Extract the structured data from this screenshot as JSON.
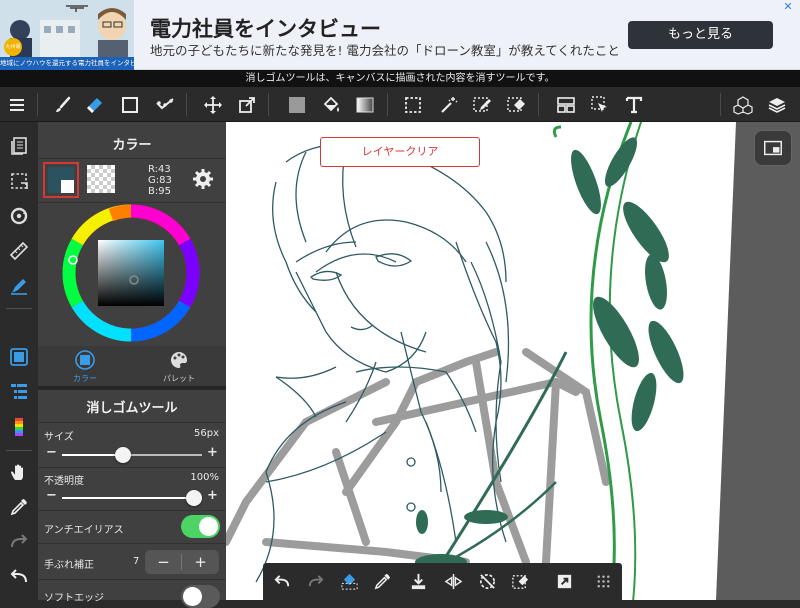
{
  "ad": {
    "title": "電力社員をインタビュー",
    "description": "地元の子どもたちに新たな発見を! 電力会社の「ドローン教室」が教えてくれたこと",
    "button_label": "もっと見る",
    "image_caption": "地域にノウハウを還元する電力社員をインタビュー!",
    "image_badge": "九州電力",
    "close_glyph": "✕"
  },
  "tool_hint": "消しゴムツールは、キャンバスに描画された内容を消すツールです。",
  "colors": {
    "accent": "#3a9be6",
    "toggle_on": "#4cd464",
    "current_color": "#2B535F",
    "selected_border": "#d23a3a",
    "canvas_line": "#2f5a63",
    "leaf_green": "#2f6b55",
    "stem_green": "#2e9b48"
  },
  "color_panel": {
    "title": "カラー",
    "rgb": {
      "r": "R:43",
      "g": "G:83",
      "b": "B:95"
    },
    "tabs": [
      {
        "label": "カラー",
        "icon": "color-square-icon",
        "active": true
      },
      {
        "label": "パレット",
        "icon": "palette-icon",
        "active": false
      }
    ]
  },
  "tool_panel": {
    "title": "消しゴムツール",
    "size": {
      "label": "サイズ",
      "value": "56px",
      "level": 0.43
    },
    "opacity": {
      "label": "不透明度",
      "value": "100%",
      "level": 1.0
    },
    "antialias": {
      "label": "アンチエイリアス",
      "on": true
    },
    "stabilizer": {
      "label": "手ぶれ補正",
      "value": "7",
      "minus": "−",
      "plus": "+"
    },
    "soft_edge": {
      "label": "ソフトエッジ",
      "on": false
    },
    "minus": "−",
    "plus": "+"
  },
  "canvas": {
    "overlay_button": "レイヤークリア"
  },
  "toolbar_icons": [
    "menu-icon",
    "brush-icon",
    "eraser-icon",
    "rectangle-icon",
    "correction-icon",
    "move-icon",
    "transform-icon",
    "fill-color-icon",
    "bucket-icon",
    "gradient-icon",
    "select-rect-icon",
    "magic-wand-icon",
    "select-pen-icon",
    "select-eraser-icon",
    "frame-divider-icon",
    "operation-icon",
    "text-icon",
    "3d-material-icon",
    "layers-icon"
  ]
}
